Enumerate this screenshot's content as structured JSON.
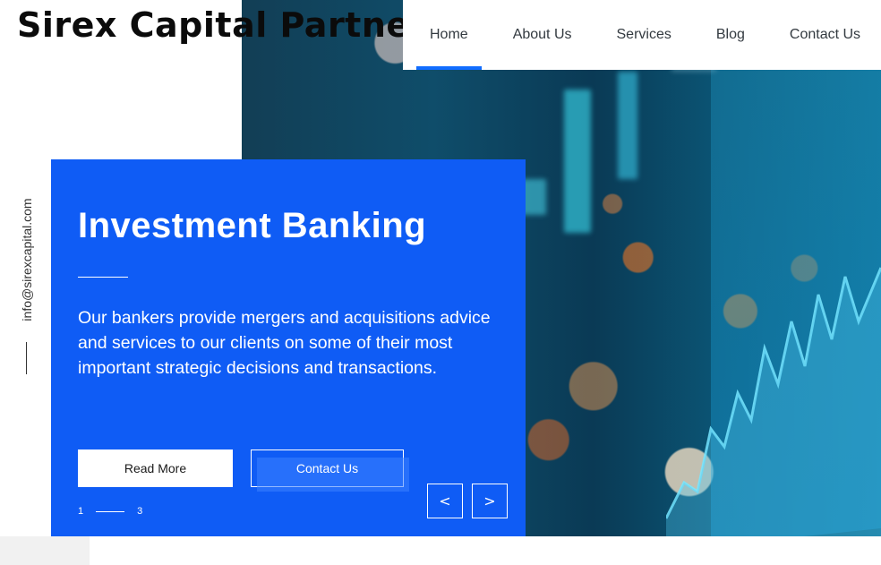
{
  "brand": {
    "name": "Sirex Capital Partners"
  },
  "nav": {
    "items": [
      {
        "label": "Home",
        "active": true
      },
      {
        "label": "About Us",
        "active": false
      },
      {
        "label": "Services",
        "active": false
      },
      {
        "label": "Blog",
        "active": false
      },
      {
        "label": "Contact Us",
        "active": false
      }
    ]
  },
  "sidebar": {
    "email": "info@sirexcapital.com"
  },
  "hero": {
    "title": "Investment Banking",
    "description": "Our bankers provide mergers and acquisitions advice and services to our clients on some of their most important strategic decisions and transactions.",
    "primary_button": "Read More",
    "secondary_button": "Contact Us",
    "pager": {
      "current": "1",
      "total": "3"
    },
    "prev_arrow": "<",
    "next_arrow": ">"
  },
  "colors": {
    "accent": "#116dff",
    "card": "#0f5cf5",
    "text_dark": "#0b0b0b"
  },
  "icons": {
    "prev": "chevron-left-icon",
    "next": "chevron-right-icon"
  }
}
